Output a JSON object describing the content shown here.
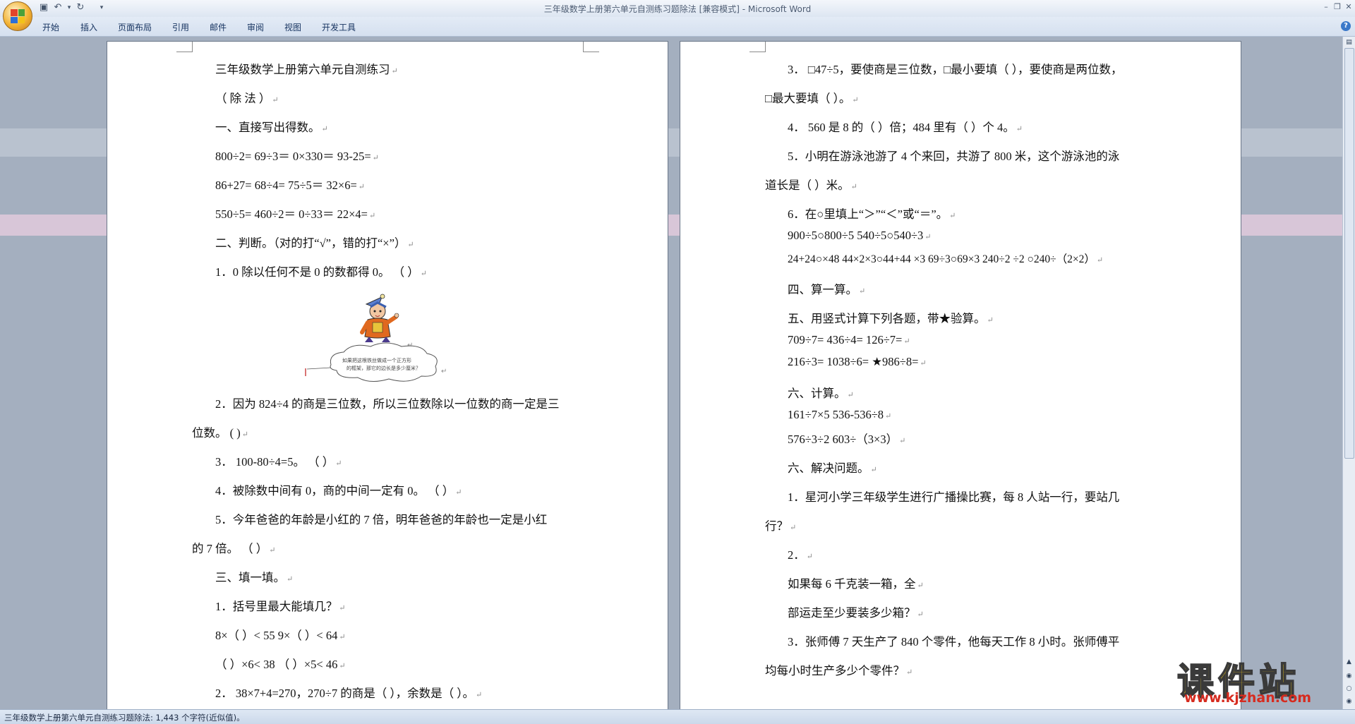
{
  "window": {
    "title": "三年级数学上册第六单元自测练习题除法 [兼容模式] - Microsoft Word",
    "min_icon": "minimize-icon",
    "max_icon": "restore-icon",
    "close_icon": "close-icon"
  },
  "quick_access": [
    "save-icon",
    "undo-icon",
    "redo-icon",
    "customize-icon"
  ],
  "ribbon": {
    "tabs": [
      "开始",
      "插入",
      "页面布局",
      "引用",
      "邮件",
      "审阅",
      "视图",
      "开发工具"
    ],
    "help": "?"
  },
  "left_page": {
    "lines": [
      "三年级数学上册第六单元自测练习",
      "（ 除 法 ）",
      "一、直接写出得数。",
      "800÷2= 69÷3＝ 0×330＝ 93-25=",
      "86+27= 68÷4= 75÷5＝ 32×6=",
      "550÷5= 460÷2＝ 0÷33＝ 22×4=",
      "二、判断。（对的打“√”，错的打“×”）",
      "1．0 除以任何不是 0 的数都得 0。 （ ）",
      "2．因为 824÷4 的商是三位数，所以三位数除以一位数的商一定是三",
      "位数。 ( )",
      "3． 100-80÷4=5。 （ ）",
      "4．被除数中间有 0，商的中间一定有 0。 （ ）",
      "5．今年爸爸的年龄是小红的 7 倍，明年爸爸的年龄也一定是小红",
      "的 7 倍。 （ ）",
      "三、填一填。",
      "1．括号里最大能填几？",
      "8×（ ）< 55 9×（ ）< 64",
      " （ ）×6< 38 （ ）×5< 46",
      "2． 38×7+4=270，270÷7 的商是（ ），余数是（ ）。"
    ],
    "bubble_text": "如果把这根铁丝做成一个正方形的框架，那它的边长是多少厘米？"
  },
  "right_page": {
    "lines": [
      "3． □47÷5，要使商是三位数，□最小要填（ ），要使商是两位数，",
      "□最大要填（ ）。",
      "4． 560 是 8 的（ ）倍；484 里有（ ）个 4。",
      "5．小明在游泳池游了 4 个来回，共游了 800 米，这个游泳池的泳",
      "道长是（ ）米。",
      "6．在○里填上“＞”“＜”或“＝”。",
      "900÷5○800÷5 540÷5○540÷3",
      "24+24○×48 44×2×3○44+44 ×3 69÷3○69×3 240÷2 ÷2 ○240÷（2×2）",
      "四、算一算。",
      "五、用竖式计算下列各题，带★验算。",
      "709÷7= 436÷4= 126÷7=",
      "216÷3= 1038÷6= ★986÷8=",
      "六、计算。",
      "161÷7×5 536-536÷8",
      "576÷3÷2 603÷（3×3）",
      "六、解决问题。",
      "1．星河小学三年级学生进行广播操比赛，每 8 人站一行，要站几",
      "行？",
      "2．",
      "如果每 6 千克装一箱，全",
      "部运走至少要装多少箱？",
      "3．张师傅 7 天生产了 840 个零件，他每天工作 8 小时。张师傅平",
      "均每小时生产多少个零件？"
    ]
  },
  "status_bar": {
    "text": "三年级数学上册第六单元自测练习题除法: 1,443 个字符(近似值)。"
  },
  "watermark": {
    "big": "课件站",
    "url": "www.kjzhan.com"
  },
  "colors": {
    "workspace": "#a4afbf",
    "ribbon": "#dbe5f2",
    "watermark_yellow": "#f8d11a",
    "watermark_red": "#d62b1f"
  }
}
